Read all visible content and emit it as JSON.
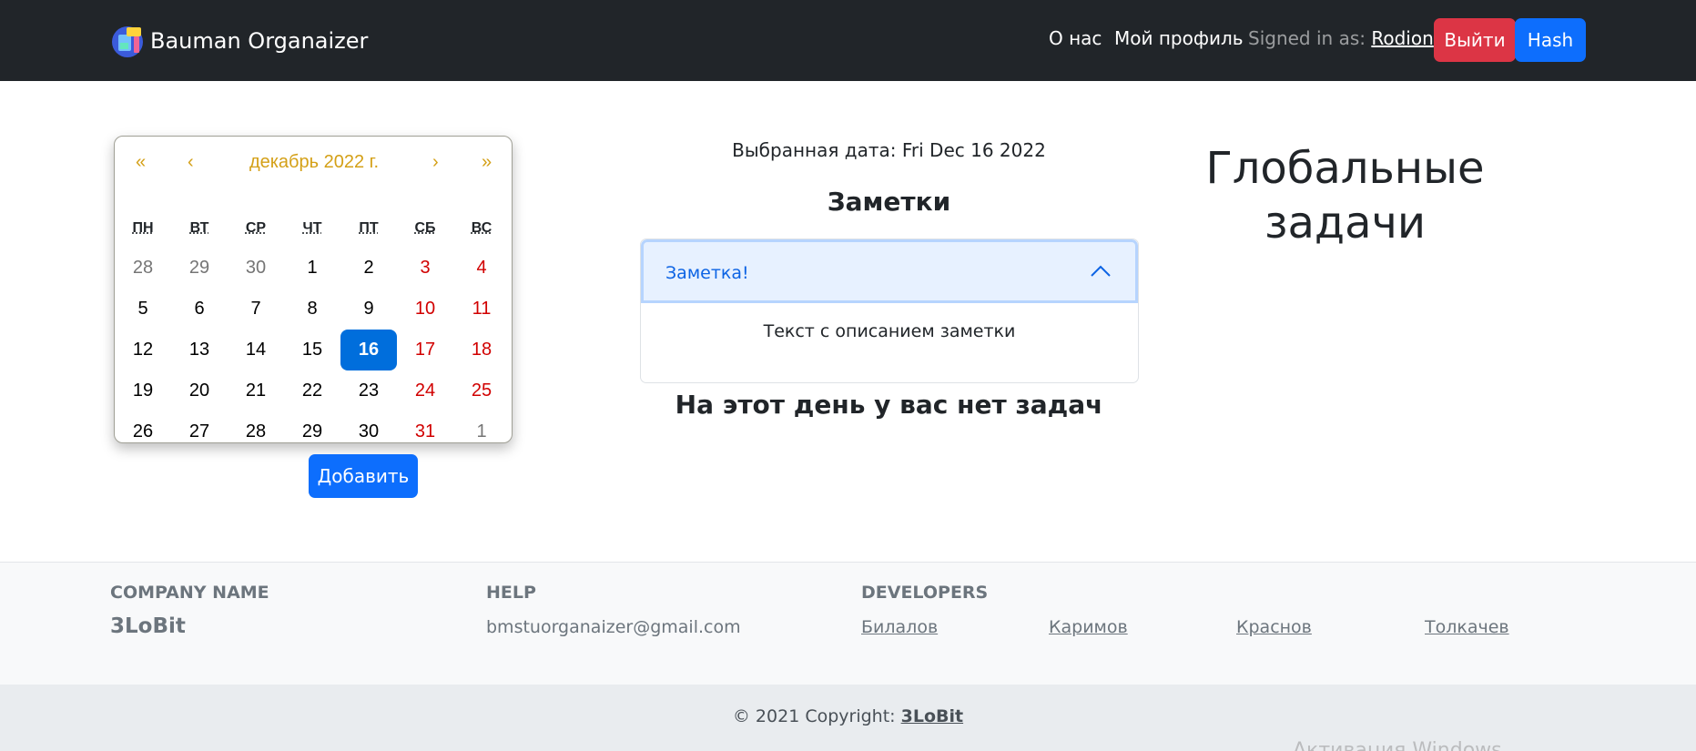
{
  "navbar": {
    "brand": "Bauman Organaizer",
    "links": {
      "about": "О нас",
      "profile": "Мой профиль"
    },
    "signed_in_label": "Signed in as:",
    "user": "Rodion",
    "logout_label": "Выйти",
    "hash_label": "Hash"
  },
  "calendar": {
    "nav": {
      "prev_year": "«",
      "prev_month": "‹",
      "next_month": "›",
      "next_year": "»"
    },
    "title": "декабрь 2022 г.",
    "weekdays": [
      "ПН",
      "ВТ",
      "СР",
      "ЧТ",
      "ПТ",
      "СБ",
      "ВС"
    ],
    "days": [
      {
        "d": "28",
        "t": "muted"
      },
      {
        "d": "29",
        "t": "muted"
      },
      {
        "d": "30",
        "t": "muted"
      },
      {
        "d": "1",
        "t": ""
      },
      {
        "d": "2",
        "t": ""
      },
      {
        "d": "3",
        "t": "weekend"
      },
      {
        "d": "4",
        "t": "weekend"
      },
      {
        "d": "5",
        "t": ""
      },
      {
        "d": "6",
        "t": ""
      },
      {
        "d": "7",
        "t": ""
      },
      {
        "d": "8",
        "t": ""
      },
      {
        "d": "9",
        "t": ""
      },
      {
        "d": "10",
        "t": "weekend"
      },
      {
        "d": "11",
        "t": "weekend"
      },
      {
        "d": "12",
        "t": ""
      },
      {
        "d": "13",
        "t": ""
      },
      {
        "d": "14",
        "t": ""
      },
      {
        "d": "15",
        "t": ""
      },
      {
        "d": "16",
        "t": "selected"
      },
      {
        "d": "17",
        "t": "weekend"
      },
      {
        "d": "18",
        "t": "weekend"
      },
      {
        "d": "19",
        "t": ""
      },
      {
        "d": "20",
        "t": ""
      },
      {
        "d": "21",
        "t": ""
      },
      {
        "d": "22",
        "t": ""
      },
      {
        "d": "23",
        "t": ""
      },
      {
        "d": "24",
        "t": "weekend"
      },
      {
        "d": "25",
        "t": "weekend"
      },
      {
        "d": "26",
        "t": ""
      },
      {
        "d": "27",
        "t": ""
      },
      {
        "d": "28",
        "t": ""
      },
      {
        "d": "29",
        "t": ""
      },
      {
        "d": "30",
        "t": ""
      },
      {
        "d": "31",
        "t": "weekend"
      },
      {
        "d": "1",
        "t": "muted"
      }
    ],
    "add_label": "Добавить"
  },
  "main": {
    "selected_date": "Выбранная дата: Fri Dec 16 2022",
    "notes_title": "Заметки",
    "note": {
      "title": "Заметка!",
      "body": "Текст с описанием заметки"
    },
    "no_tasks": "На этот день у вас нет задач"
  },
  "global_tasks_title": "Глобальные задачи",
  "footer": {
    "company_head": "COMPANY NAME",
    "company_name": "3LoBit",
    "help_head": "HELP",
    "help_email": "bmstuorganaizer@gmail.com",
    "dev_head": "DEVELOPERS",
    "developers": [
      "Билалов",
      "Каримов",
      "Краснов",
      "Толкачев"
    ],
    "copyright_prefix": "© 2021 Copyright:",
    "copyright_link": "3LoBit"
  },
  "watermark": "Активация Windows",
  "colors": {
    "navbar": "#212529",
    "danger": "#dc3545",
    "primary": "#0d6efd",
    "calendar_accent": "#d4a017",
    "weekend": "#d10000",
    "selected_day": "#006edc"
  }
}
